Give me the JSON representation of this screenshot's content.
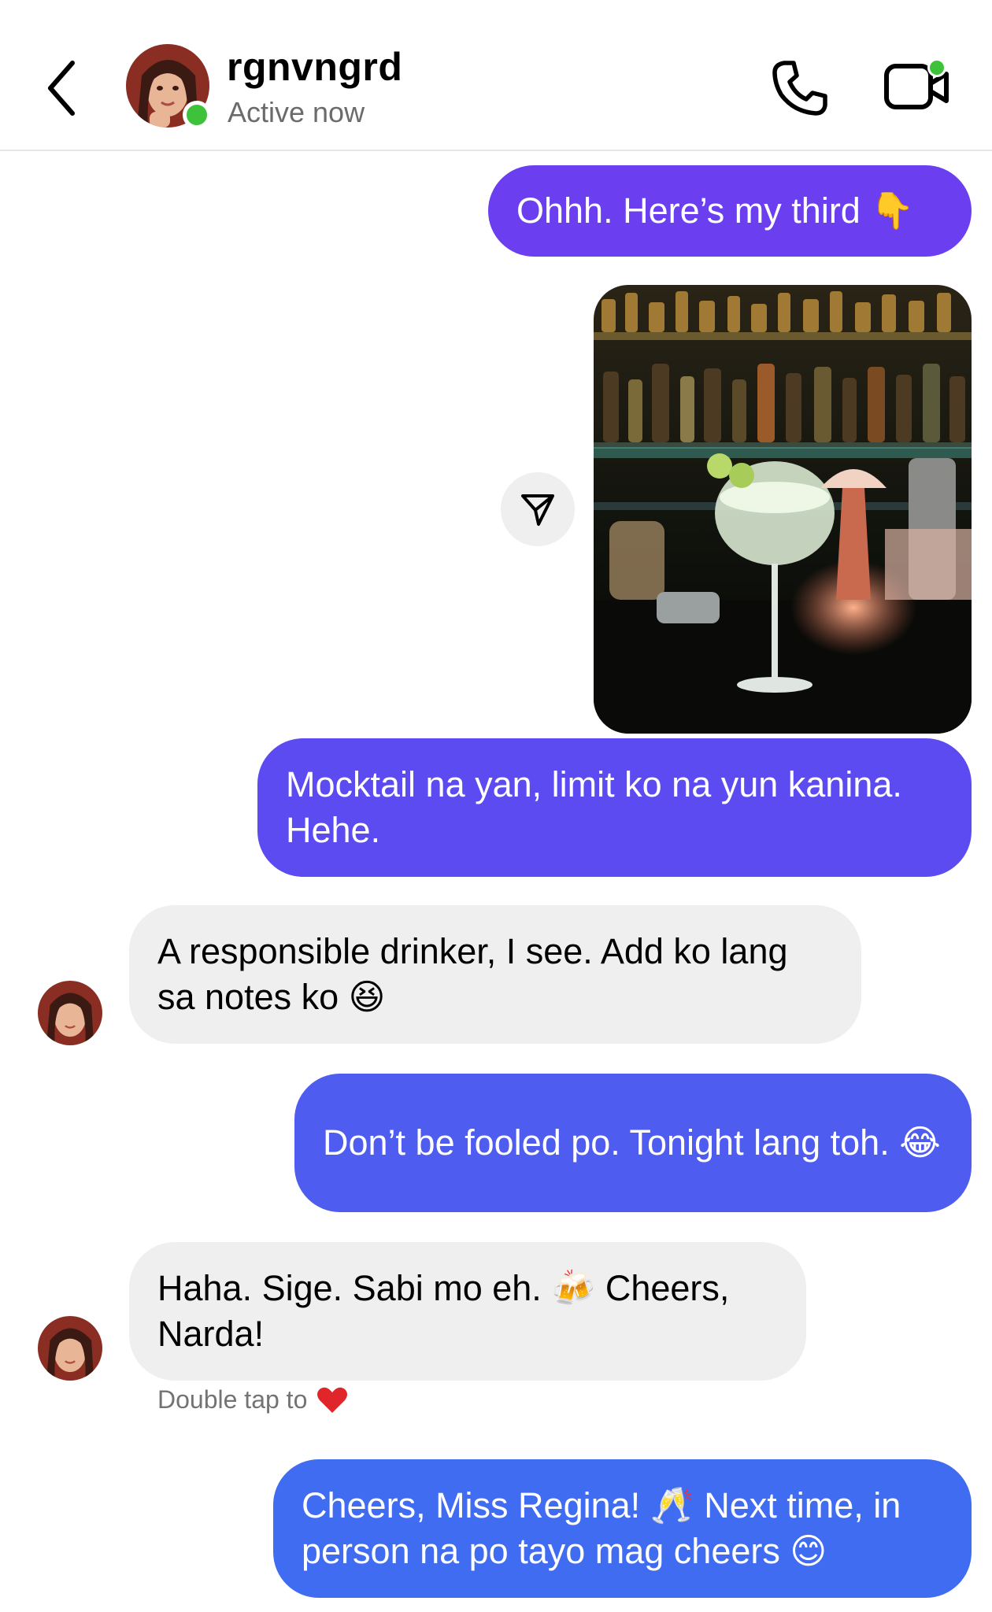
{
  "header": {
    "username": "rgnvngrd",
    "status": "Active now"
  },
  "messages": [
    {
      "direction": "out",
      "text": "Ohhh. Here’s my third 👇"
    },
    {
      "direction": "out",
      "type": "photo"
    },
    {
      "direction": "out",
      "text": "Mocktail na yan, limit ko na yun kanina. Hehe."
    },
    {
      "direction": "in",
      "text": "A responsible drinker, I see. Add ko lang sa notes ko 😆"
    },
    {
      "direction": "out",
      "text": "Don’t be fooled po. Tonight lang toh. 😂"
    },
    {
      "direction": "in",
      "text": "Haha. Sige. Sabi mo eh. 🍻 Cheers, Narda!"
    },
    {
      "direction": "out",
      "text": "Cheers, Miss Regina! 🥂 Next time, in person na po tayo mag cheers 😊"
    }
  ],
  "reaction_hint": {
    "text": "Double tap to",
    "icon": "heart-icon"
  },
  "colors": {
    "bubble_out_1": "#6b3ff0",
    "bubble_out_2": "#5b4bf0",
    "bubble_out_3": "#4e5cef",
    "bubble_out_4": "#3f6cf0",
    "bubble_in": "#efefef",
    "online": "#3ec23a"
  }
}
